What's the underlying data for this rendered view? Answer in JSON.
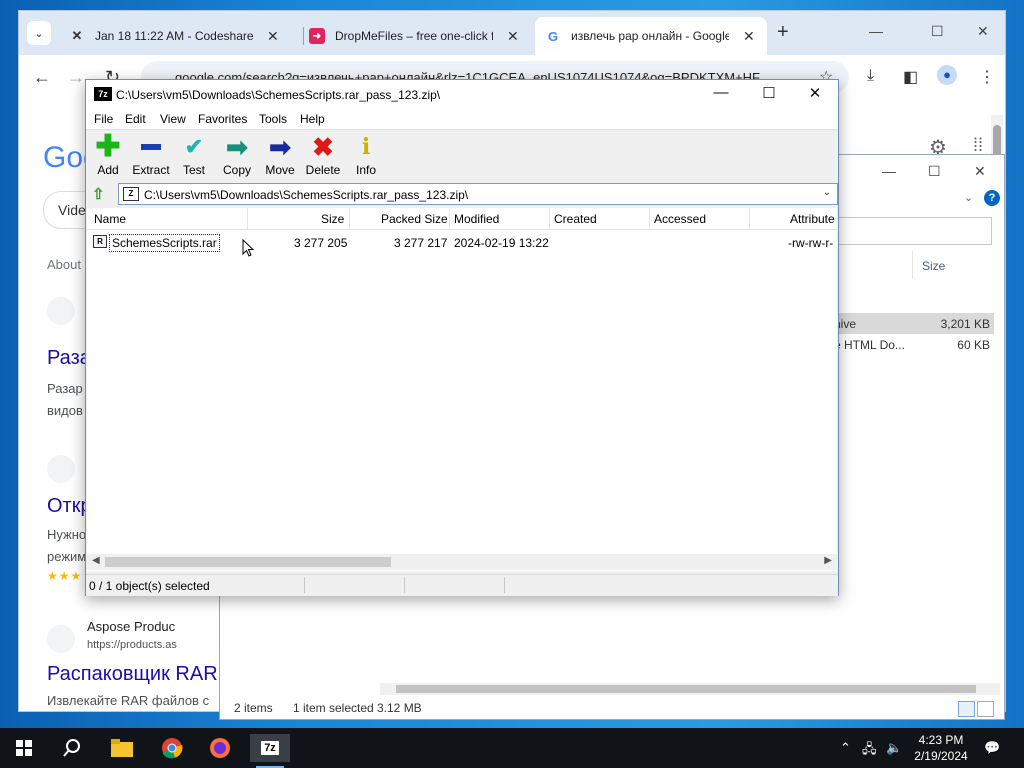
{
  "chrome": {
    "tabs": [
      {
        "title": "Jan 18 11:22 AM - Codeshare",
        "icon": "codeshare-icon"
      },
      {
        "title": "DropMeFiles – free one-click fil",
        "icon": "dropmefiles-icon"
      },
      {
        "title": "извлечь рар онлайн - Google",
        "icon": "google-icon"
      }
    ],
    "address": "google.com/search?q=извлечь+рар+онлайн&rlz=1C1GCEA_enUS1074US1074&oq=BPDKTXM+HF...",
    "google": {
      "logo": "Goo",
      "pill": "Vide",
      "about": "About",
      "results": [
        {
          "title": "Раза",
          "snippet1": "Разар",
          "snippet2": "видов"
        },
        {
          "title": "Откр",
          "snippet1": "Нужно",
          "snippet2": "режим"
        },
        {
          "site": "Aspose Produc",
          "url": "https://products.as",
          "title": "Распаковщик RAR",
          "snippet1": "Извлекайте RAR файлов с"
        }
      ],
      "stars": "★★★"
    }
  },
  "explorer": {
    "size_header": "Size",
    "rows": [
      {
        "name": "hive",
        "size": "3,201 KB",
        "selected": true
      },
      {
        "name": "e HTML Do...",
        "size": "60 KB",
        "selected": false
      }
    ],
    "status": {
      "items": "2 items",
      "selected": "1 item selected",
      "size": "3.12 MB"
    }
  },
  "sevenzip": {
    "title": "C:\\Users\\vm5\\Downloads\\SchemesScripts.rar_pass_123.zip\\",
    "menu": [
      "File",
      "Edit",
      "View",
      "Favorites",
      "Tools",
      "Help"
    ],
    "toolbar": [
      "Add",
      "Extract",
      "Test",
      "Copy",
      "Move",
      "Delete",
      "Info"
    ],
    "address": "C:\\Users\\vm5\\Downloads\\SchemesScripts.rar_pass_123.zip\\",
    "columns": [
      "Name",
      "Size",
      "Packed Size",
      "Modified",
      "Created",
      "Accessed",
      "Attribute"
    ],
    "rows": [
      {
        "name": "SchemesScripts.rar",
        "size": "3 277 205",
        "packed": "3 277 217",
        "modified": "2024-02-19 13:22",
        "created": "",
        "accessed": "",
        "attributes": "-rw-rw-r-"
      }
    ],
    "status": "0 / 1 object(s) selected"
  },
  "taskbar": {
    "time": "4:23 PM",
    "date": "2/19/2024"
  },
  "colors": {
    "accent": "#0067c0",
    "link": "#1a0dab",
    "desktop": "#1b86d6"
  }
}
